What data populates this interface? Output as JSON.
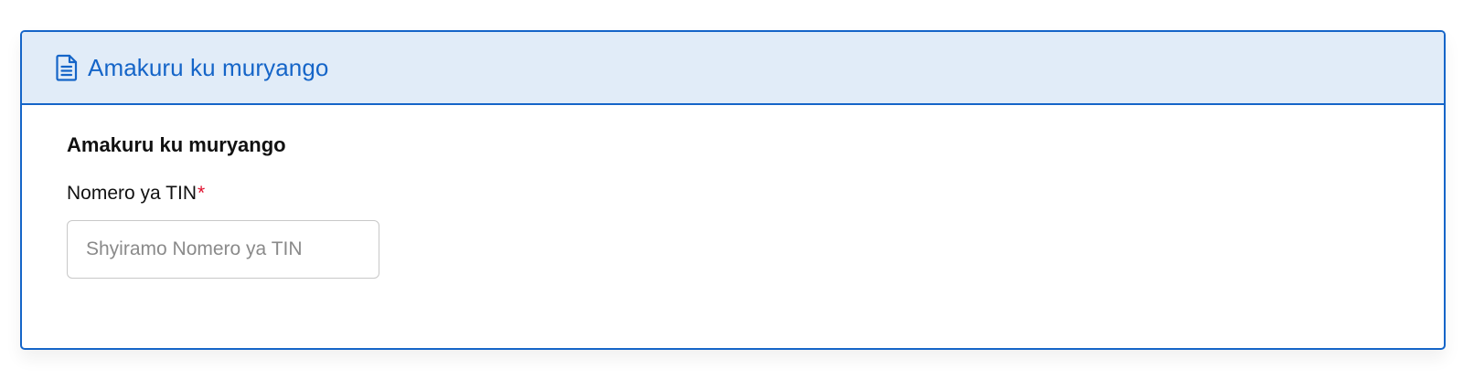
{
  "card": {
    "header_title": "Amakuru ku muryango",
    "header_icon": "document-icon",
    "accent_color": "#1565c8",
    "header_bg_color": "#e1ecf8"
  },
  "section": {
    "title": "Amakuru ku muryango"
  },
  "tin_field": {
    "label": "Nomero ya TIN",
    "required_mark": "*",
    "value": "",
    "placeholder": "Shyiramo Nomero ya TIN"
  }
}
